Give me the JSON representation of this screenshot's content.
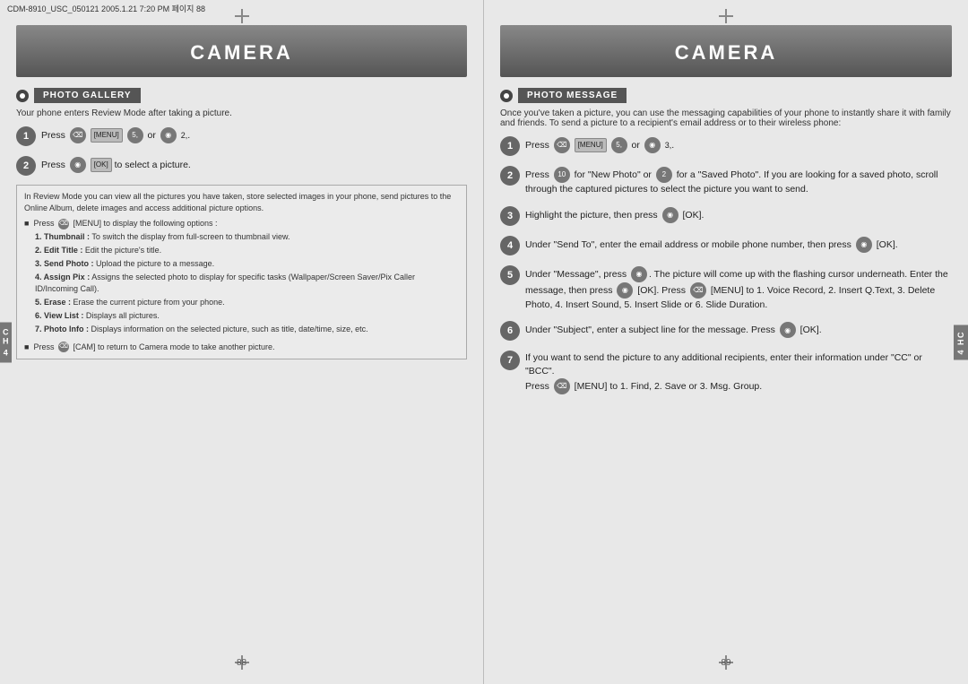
{
  "meta": {
    "top_bar": "CDM-8910_USC_050121 2005.1.21 7:20 PM 페이지 88"
  },
  "left_page": {
    "header": "CAMERA",
    "section": {
      "title": "PHOTO GALLERY",
      "subtitle": "Your phone enters Review Mode after taking a picture."
    },
    "steps": [
      {
        "number": "1",
        "text": "Press [MENU] or ."
      },
      {
        "number": "2",
        "text": "Press [OK] to select a picture."
      }
    ],
    "info_box": {
      "intro": "In Review Mode you can view all the pictures you have taken, store selected images in your phone, send pictures to the Online Album, delete images and access additional picture options.",
      "bullets": [
        {
          "text": "Press [MENU] to display the following options :"
        }
      ],
      "numbered_items": [
        "1. Thumbnail : To switch the display from full-screen to thumbnail view.",
        "2. Edit Title : Edit the picture's title.",
        "3. Send Photo : Upload the picture to a message.",
        "4. Assign Pix : Assigns the selected photo to display for specific tasks (Wallpaper/Screen Saver/Pix Caller ID/Incoming Call).",
        "5. Erase : Erase the current picture from your phone.",
        "6. View List : Displays all pictures.",
        "7. Photo Info : Displays information on the selected picture, such as title, date/time, size, etc."
      ],
      "footer_bullet": "Press [CAM] to return to Camera mode to take another picture."
    },
    "page_number": "88"
  },
  "right_page": {
    "header": "CAMERA",
    "section": {
      "title": "PHOTO MESSAGE",
      "subtitle": "Once you've taken a picture, you can use the messaging capabilities of your phone to instantly share it with family and friends. To send a picture to a recipient's email address or to their wireless phone:"
    },
    "steps": [
      {
        "number": "1",
        "text": "Press [MENU] or ."
      },
      {
        "number": "2",
        "text": "Press for \"New Photo\" or for a \"Saved Photo\". If you are looking for a saved photo, scroll through the captured pictures to select the picture you want to send."
      },
      {
        "number": "3",
        "text": "Highlight the picture, then press [OK]."
      },
      {
        "number": "4",
        "text": "Under \"Send To\", enter the email address or mobile phone number, then press [OK]."
      },
      {
        "number": "5",
        "text": "Under \"Message\", press . The picture will come up with the flashing cursor underneath. Enter the message, then press [OK]. Press [MENU] to 1. Voice Record, 2. Insert Q.Text, 3. Delete Photo, 4. Insert Sound, 5. Insert Slide or 6. Slide Duration."
      },
      {
        "number": "6",
        "text": "Under \"Subject\", enter a subject line for the message. Press [OK]."
      },
      {
        "number": "7",
        "text": "If you want to send the picture to any additional recipients, enter their information under \"CC\" or \"BCC\".\nPress [MENU] to 1. Find, 2. Save or 3. Msg. Group."
      }
    ],
    "page_number": "89"
  },
  "ch_label": "CH\n4"
}
